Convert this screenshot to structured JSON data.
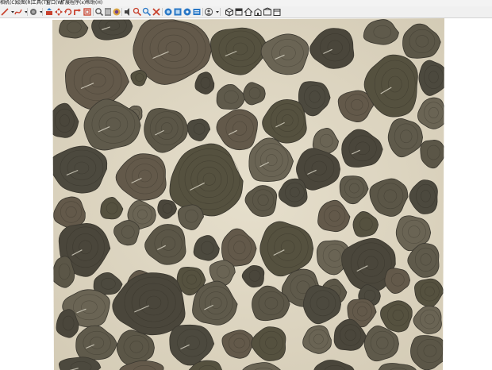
{
  "menubar": {
    "items": [
      {
        "label": "相机(C)"
      },
      {
        "label": "绘图(R)"
      },
      {
        "label": "工具(T)"
      },
      {
        "label": "窗口(W)"
      },
      {
        "label": "扩展程序(x)"
      },
      {
        "label": "帮助(H)"
      }
    ]
  },
  "toolbar": {
    "tools": [
      {
        "icon": "line-tool-icon"
      },
      {
        "icon": "freehand-tool-icon"
      },
      {
        "icon": "paint-bucket-icon"
      },
      {
        "icon": "push-pull-icon"
      },
      {
        "icon": "move-icon"
      },
      {
        "icon": "rotate-icon"
      },
      {
        "icon": "follow-me-icon"
      },
      {
        "icon": "offset-icon"
      },
      {
        "icon": "tape-measure-icon"
      },
      {
        "icon": "dimension-icon"
      },
      {
        "icon": "text-icon"
      },
      {
        "icon": "orbit-icon"
      },
      {
        "icon": "pan-icon"
      },
      {
        "icon": "zoom-icon"
      },
      {
        "icon": "zoom-extents-icon"
      },
      {
        "icon": "add-location-icon"
      },
      {
        "icon": "warehouse-icon"
      },
      {
        "icon": "extension-warehouse-icon"
      },
      {
        "icon": "account-icon"
      },
      {
        "icon": "iso-view-icon"
      },
      {
        "icon": "top-view-icon"
      },
      {
        "icon": "front-view-icon"
      },
      {
        "icon": "right-view-icon"
      },
      {
        "icon": "back-view-icon"
      },
      {
        "icon": "left-view-icon"
      }
    ]
  },
  "colors": {
    "mortar": "#ded6c2",
    "stone_dark": "#4a473d",
    "stone_mid": "#5c574a",
    "stone_light": "#70695a",
    "icon_red": "#c8402c",
    "icon_blue": "#2a78c6",
    "icon_gray": "#6a6a6a"
  },
  "viewport": {
    "texture": "wood-log-end-stone-paving"
  }
}
